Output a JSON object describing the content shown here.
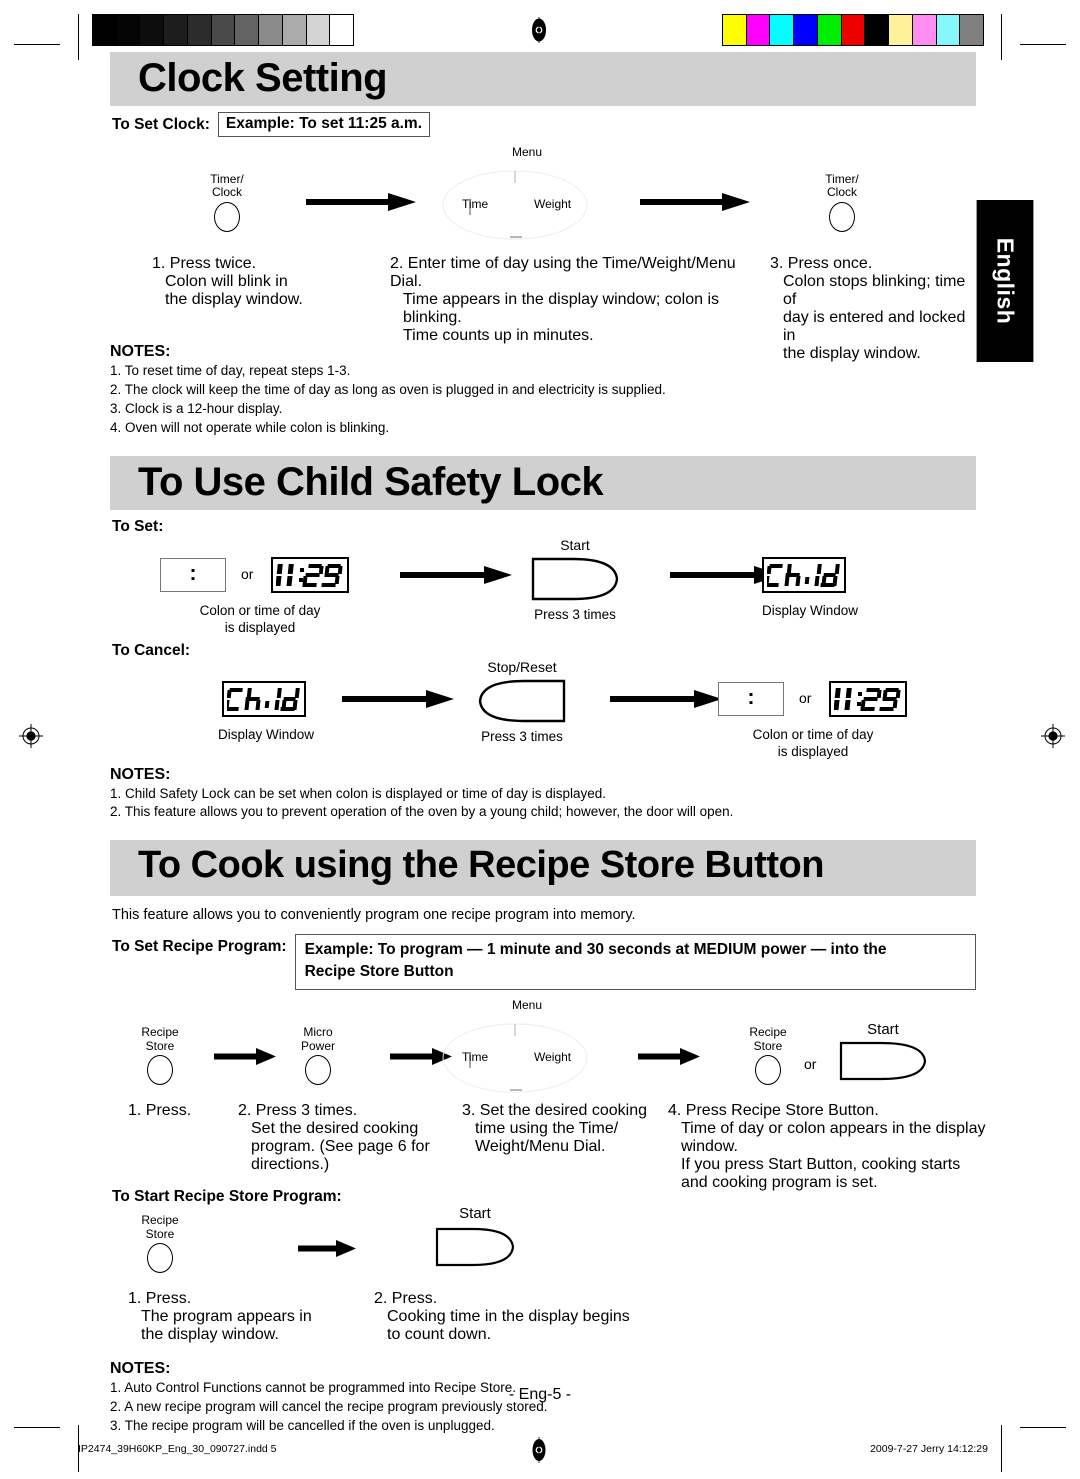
{
  "doc": {
    "language_tab": "English",
    "page_number": "- Eng-5 -",
    "footer_left": "IP2474_39H60KP_Eng_30_090727.indd   5",
    "footer_right": "2009-7-27   Jerry 14:12:29"
  },
  "calibration": {
    "grayscale": [
      "#000000",
      "#050505",
      "#0d0d0d",
      "#1d1d1d",
      "#2c2c2c",
      "#4a4a4a",
      "#636363",
      "#8a8a8a",
      "#ababab",
      "#d4d4d4",
      "#ffffff"
    ],
    "colors": [
      "#ffff00",
      "#ff00ff",
      "#00ffff",
      "#0000ff",
      "#00ee00",
      "#ee0000",
      "#000000",
      "#fdf19a",
      "#ff8cf0",
      "#84f7fb",
      "#808080"
    ]
  },
  "section_clock": {
    "heading": "Clock Setting",
    "to_set_label": "To Set Clock:",
    "example": "Example: To set 11:25 a.m.",
    "diagram": {
      "dial_menu": "Menu",
      "dial_time": "Time",
      "dial_weight": "Weight",
      "key1": "Timer/\nClock",
      "key2": "Timer/\nClock"
    },
    "steps": [
      "1. Press twice.\nColon will blink in\nthe display window.",
      "2. Enter time of day using the Time/Weight/Menu Dial.\nTime appears in the display window; colon is\nblinking.\nTime counts up in minutes.",
      "3. Press once.\nColon stops blinking; time of\nday is entered and locked in\nthe display window."
    ],
    "steps_lines": {
      "s1": [
        "1. Press twice.",
        "Colon will blink in",
        "the display window."
      ],
      "s2": [
        "2. Enter time of day using the Time/Weight/Menu Dial.",
        "Time appears in the display window; colon is",
        "blinking.",
        "Time counts up in minutes."
      ],
      "s3": [
        "3. Press once.",
        "Colon stops blinking; time of",
        "day is entered and locked in",
        "the display window."
      ]
    },
    "notes_title": "NOTES:",
    "notes": [
      "1. To reset time of day, repeat steps 1-3.",
      "2. The clock will keep the time of day as long as oven is plugged in and electricity is supplied.",
      "3. Clock is a 12-hour display.",
      "4. Oven will not operate while colon is blinking."
    ]
  },
  "section_child_lock": {
    "heading": "To Use Child Safety Lock",
    "to_set_label": "To Set:",
    "set_row": {
      "display_blank": ":",
      "or": "or",
      "display_time": "11:25",
      "caption_left": "Colon or time of day\nis displayed",
      "caption_left_l1": "Colon or time of day",
      "caption_left_l2": "is displayed",
      "button_label": "Start",
      "caption_mid": "Press 3 times",
      "display_child": "Child",
      "caption_right": "Display Window"
    },
    "to_cancel_label": "To Cancel:",
    "cancel_row": {
      "display_child": "Child",
      "caption_left": "Display Window",
      "button_label": "Stop/Reset",
      "caption_mid": "Press 3 times",
      "display_blank": ":",
      "or": "or",
      "display_time": "11:25",
      "caption_right_l1": "Colon or time of day",
      "caption_right_l2": "is displayed"
    },
    "notes_title": "NOTES:",
    "notes": [
      "1. Child Safety Lock can be set when colon is displayed or time of day is displayed.",
      "2. This feature allows you to prevent operation of the oven by a young child; however, the door will open."
    ]
  },
  "section_recipe_store": {
    "heading": "To Cook using the Recipe Store Button",
    "intro": "This feature allows you to conveniently program one recipe program into memory.",
    "to_set_label": "To Set Recipe Program:",
    "example_l1": "Example: To program — 1 minute and 30 seconds at MEDIUM power — into the",
    "example_l2": "Recipe Store Button",
    "diagram": {
      "key1": "Recipe\nStore",
      "key2": "Micro\nPower",
      "dial_menu": "Menu",
      "dial_time": "Time",
      "dial_weight": "Weight",
      "key3": "Recipe\nStore",
      "or": "or",
      "button_label": "Start"
    },
    "steps_lines": {
      "s1": [
        "1. Press."
      ],
      "s2": [
        "2. Press 3 times.",
        "Set the desired cooking",
        "program. (See page 6 for",
        "directions.)"
      ],
      "s3": [
        "3. Set the desired cooking",
        "time using the Time/",
        "Weight/Menu Dial."
      ],
      "s4": [
        "4. Press Recipe Store Button.",
        "Time of day or colon appears in the display",
        "window.",
        "If you press Start Button, cooking starts",
        "and cooking program is set."
      ]
    },
    "start_label": "To Start Recipe Store Program:",
    "start_diagram": {
      "key1": "Recipe\nStore",
      "button_label": "Start"
    },
    "start_steps_lines": {
      "s1": [
        "1. Press.",
        "The program appears in",
        "the display window."
      ],
      "s2": [
        "2. Press.",
        "Cooking time in the display begins",
        "to count down."
      ]
    },
    "notes_title": "NOTES:",
    "notes": [
      "1. Auto Control Functions cannot be programmed into Recipe Store.",
      "2. A new recipe program will cancel the recipe program previously stored.",
      "3. The recipe program will be cancelled if the oven is unplugged."
    ]
  }
}
